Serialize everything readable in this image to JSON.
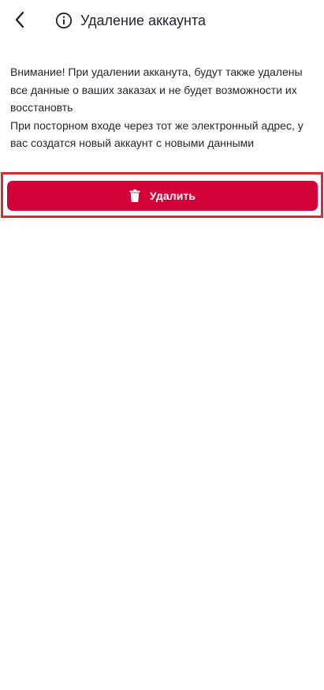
{
  "header": {
    "back_icon": "chevron-left-icon",
    "info_icon": "info-circle-icon",
    "title": "Удаление аккаунта"
  },
  "warning": {
    "paragraph_1": "Внимание! При удалении акканута, будут также удалены все данные о ваших заказах и не будет возможности их восстановть",
    "paragraph_2": "При посторном входе через тот же электронный адрес, у вас создатся новый аккаунт с новыми данными"
  },
  "delete_button": {
    "icon": "trash-icon",
    "label": "Удалить"
  },
  "colors": {
    "accent": "#d4003a",
    "highlight_frame": "#e0262f",
    "text": "#24262e"
  }
}
